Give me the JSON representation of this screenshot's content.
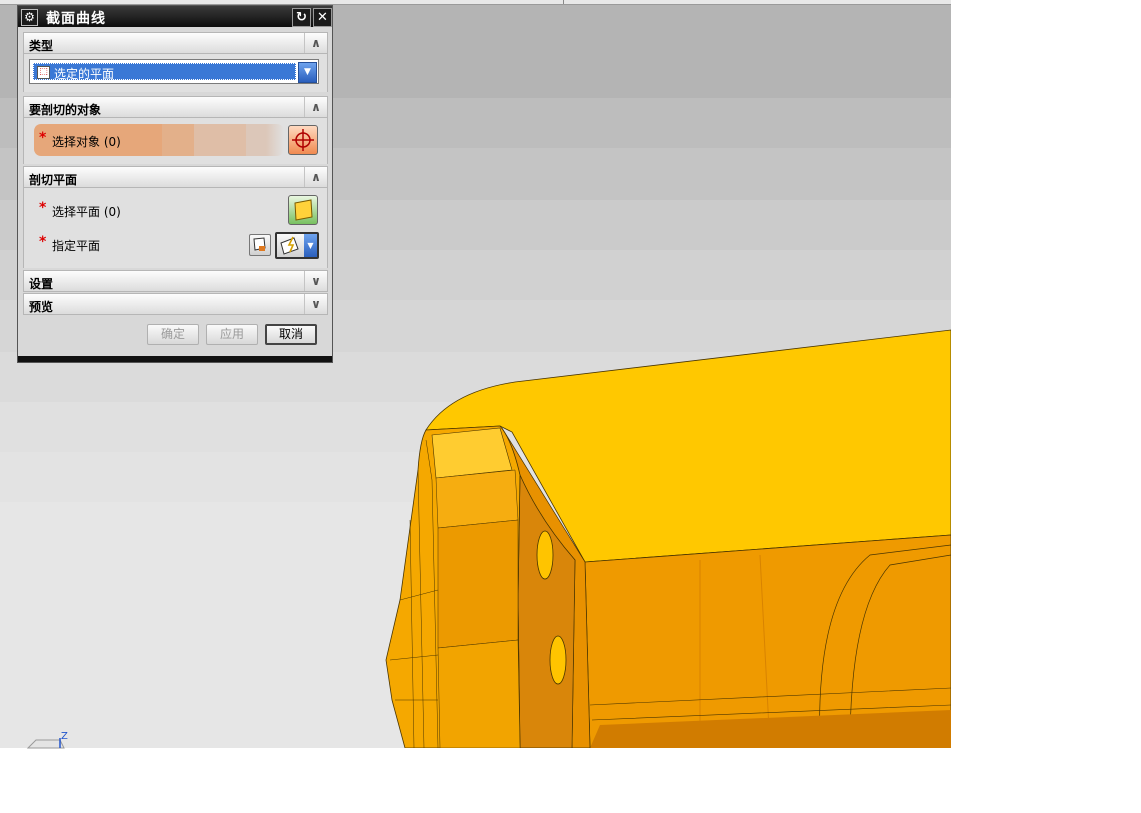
{
  "dialog": {
    "title": "截面曲线",
    "sections": {
      "type": {
        "label": "类型",
        "selected": "选定的平面"
      },
      "objects": {
        "label": "要剖切的对象",
        "select_label": "选择对象 (0)"
      },
      "plane": {
        "label": "剖切平面",
        "select_plane_label": "选择平面 (0)",
        "specify_plane_label": "指定平面"
      },
      "settings": {
        "label": "设置"
      },
      "preview": {
        "label": "预览"
      }
    },
    "buttons": {
      "ok": "确定",
      "apply": "应用",
      "cancel": "取消"
    },
    "required_mark": "*"
  },
  "viewport": {
    "axis_label": "Z"
  },
  "colors": {
    "accent": "#3a78d6",
    "model": "#ffc700",
    "title_bar": "#111111"
  },
  "icons": {
    "gear": "gear-icon",
    "reset": "reset-icon",
    "close": "close-icon",
    "collapse": "chevron-up-icon",
    "expand": "chevron-down-icon",
    "crosshair": "crosshair-icon",
    "plane": "plane-icon"
  }
}
